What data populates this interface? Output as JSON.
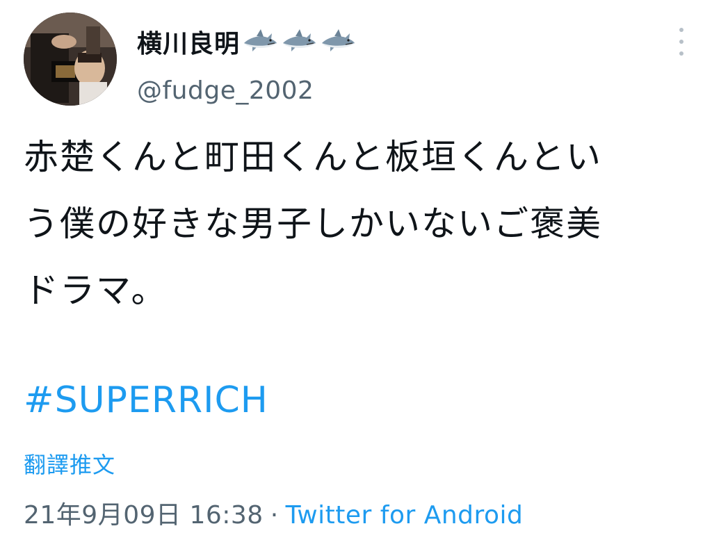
{
  "tweet": {
    "author": {
      "display_name": "横川良明",
      "emoji": [
        "shark-emoji",
        "shark-emoji",
        "shark-emoji"
      ],
      "handle": "@fudge_2002"
    },
    "text": "赤楚くんと町田くんと板垣くんとい\nう僕の好きな男子しかいないご褒美\nドラマ。",
    "hashtag": "#SUPERRICH",
    "translate_label": "翻譯推文",
    "timestamp": "21年9月09日 16:38",
    "separator": "·",
    "source": "Twitter for Android"
  },
  "colors": {
    "link": "#1d9bf0",
    "secondary_text": "#536471",
    "primary_text": "#0f1419"
  }
}
